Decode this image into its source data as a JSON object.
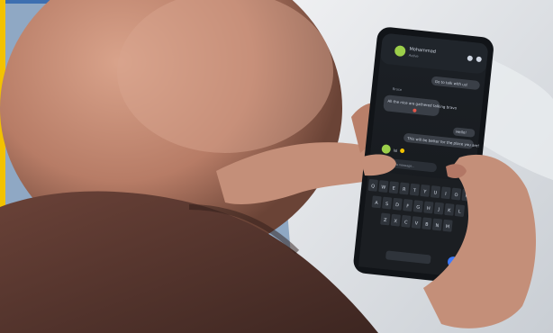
{
  "scene": {
    "subject": "person-holding-smartphone-messenger-chat",
    "colors": {
      "frame_yellow": "#f2c200",
      "background_blue": "#8fa8c4",
      "sofa_white": "#dfe2e6",
      "shirt_brown": "#5a3b33",
      "skin": "#c48f79",
      "phone_body": "#111418",
      "screen_dark": "#1d2126",
      "bubble_gray": "#3a3f47",
      "accent_blue": "#3d7bff"
    }
  },
  "phone": {
    "header": {
      "contact_name": "Mohammad",
      "status": "Active"
    },
    "messages": [
      "Go to talk with us!",
      "Bruce",
      "All the nice are gathered talking bravo",
      "Hello!",
      "This will be better for the place you are!",
      "lol"
    ],
    "composer_placeholder": "Type a message...",
    "keyboard_rows": [
      [
        "Q",
        "W",
        "E",
        "R",
        "T",
        "Y",
        "U",
        "I",
        "O",
        "P"
      ],
      [
        "A",
        "S",
        "D",
        "F",
        "G",
        "H",
        "J",
        "K",
        "L"
      ],
      [
        "Z",
        "X",
        "C",
        "V",
        "B",
        "N",
        "M"
      ]
    ]
  }
}
